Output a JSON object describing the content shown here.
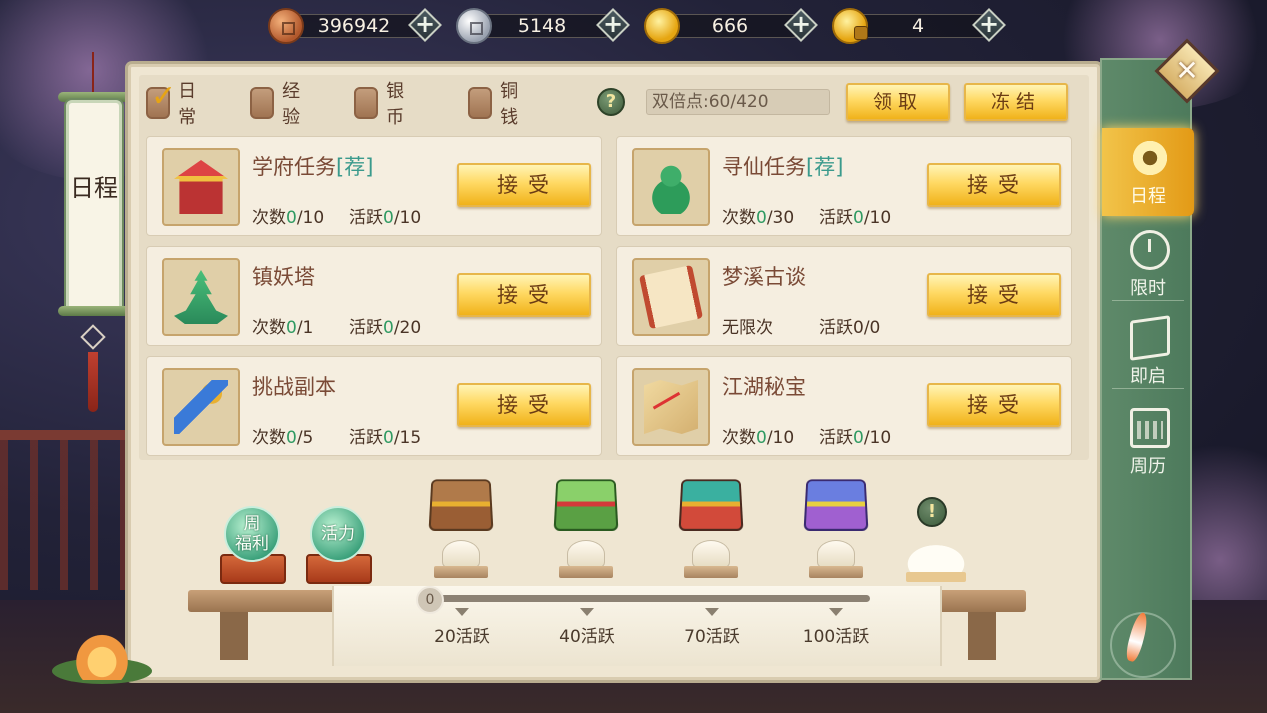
{
  "currencies": [
    {
      "icon": "copper-coin-icon",
      "value": "396942"
    },
    {
      "icon": "silver-coin-icon",
      "value": "5148"
    },
    {
      "icon": "gold-ingot-icon",
      "value": "666"
    },
    {
      "icon": "bound-gold-ingot-icon",
      "value": "4"
    }
  ],
  "plus_symbol": "+",
  "title": "日程",
  "filters": [
    {
      "label": "日常",
      "checked": true
    },
    {
      "label": "经验",
      "checked": false
    },
    {
      "label": "银币",
      "checked": false
    },
    {
      "label": "铜钱",
      "checked": false
    }
  ],
  "help_symbol": "?",
  "double_points": "双倍点:60/420",
  "buttons": {
    "claim": "领取",
    "freeze": "冻结",
    "accept": "接受"
  },
  "tasks": [
    {
      "name": "学府任务",
      "tag": "[荐]",
      "icon": "academy-building-icon",
      "count_label": "次数",
      "count_done": "0",
      "count_total": "/10",
      "active_label": "活跃",
      "active_done": "0",
      "active_total": "/10"
    },
    {
      "name": "寻仙任务",
      "tag": "[荐]",
      "icon": "gourd-icon",
      "count_label": "次数",
      "count_done": "0",
      "count_total": "/30",
      "active_label": "活跃",
      "active_done": "0",
      "active_total": "/10"
    },
    {
      "name": "镇妖塔",
      "tag": "",
      "icon": "pagoda-icon",
      "count_label": "次数",
      "count_done": "0",
      "count_total": "/1",
      "active_label": "活跃",
      "active_done": "0",
      "active_total": "/20"
    },
    {
      "name": "梦溪古谈",
      "tag": "",
      "icon": "scroll-icon",
      "count_label": "无限次",
      "count_done": "",
      "count_total": "",
      "active_label": "活跃0/0",
      "active_done": "",
      "active_total": ""
    },
    {
      "name": "挑战副本",
      "tag": "",
      "icon": "sword-icon",
      "count_label": "次数",
      "count_done": "0",
      "count_total": "/5",
      "active_label": "活跃",
      "active_done": "0",
      "active_total": "/15"
    },
    {
      "name": "江湖秘宝",
      "tag": "",
      "icon": "treasure-map-icon",
      "count_label": "次数",
      "count_done": "0",
      "count_total": "/10",
      "active_label": "活跃",
      "active_done": "0",
      "active_total": "/10"
    }
  ],
  "side_tabs": [
    {
      "label": "日程",
      "icon": "schedule-icon",
      "active": true
    },
    {
      "label": "限时",
      "icon": "timer-icon",
      "active": false
    },
    {
      "label": "即启",
      "icon": "book-icon",
      "active": false
    },
    {
      "label": "周历",
      "icon": "calendar-icon",
      "active": false
    }
  ],
  "close_symbol": "✕",
  "rewards": {
    "weekly_label": "周福利",
    "weekly_line1": "周",
    "weekly_line2": "福利",
    "energy_label": "活力",
    "progress_value": "0",
    "progress_current": 0,
    "milestones": [
      "20活跃",
      "40活跃",
      "70活跃",
      "100活跃"
    ],
    "alert_symbol": "!"
  },
  "colors": {
    "accent_gold": "#ffd963",
    "progress_green": "#2f9a62",
    "recommend_teal": "#3a9a8c",
    "tab_green": "#5f8a6a"
  }
}
